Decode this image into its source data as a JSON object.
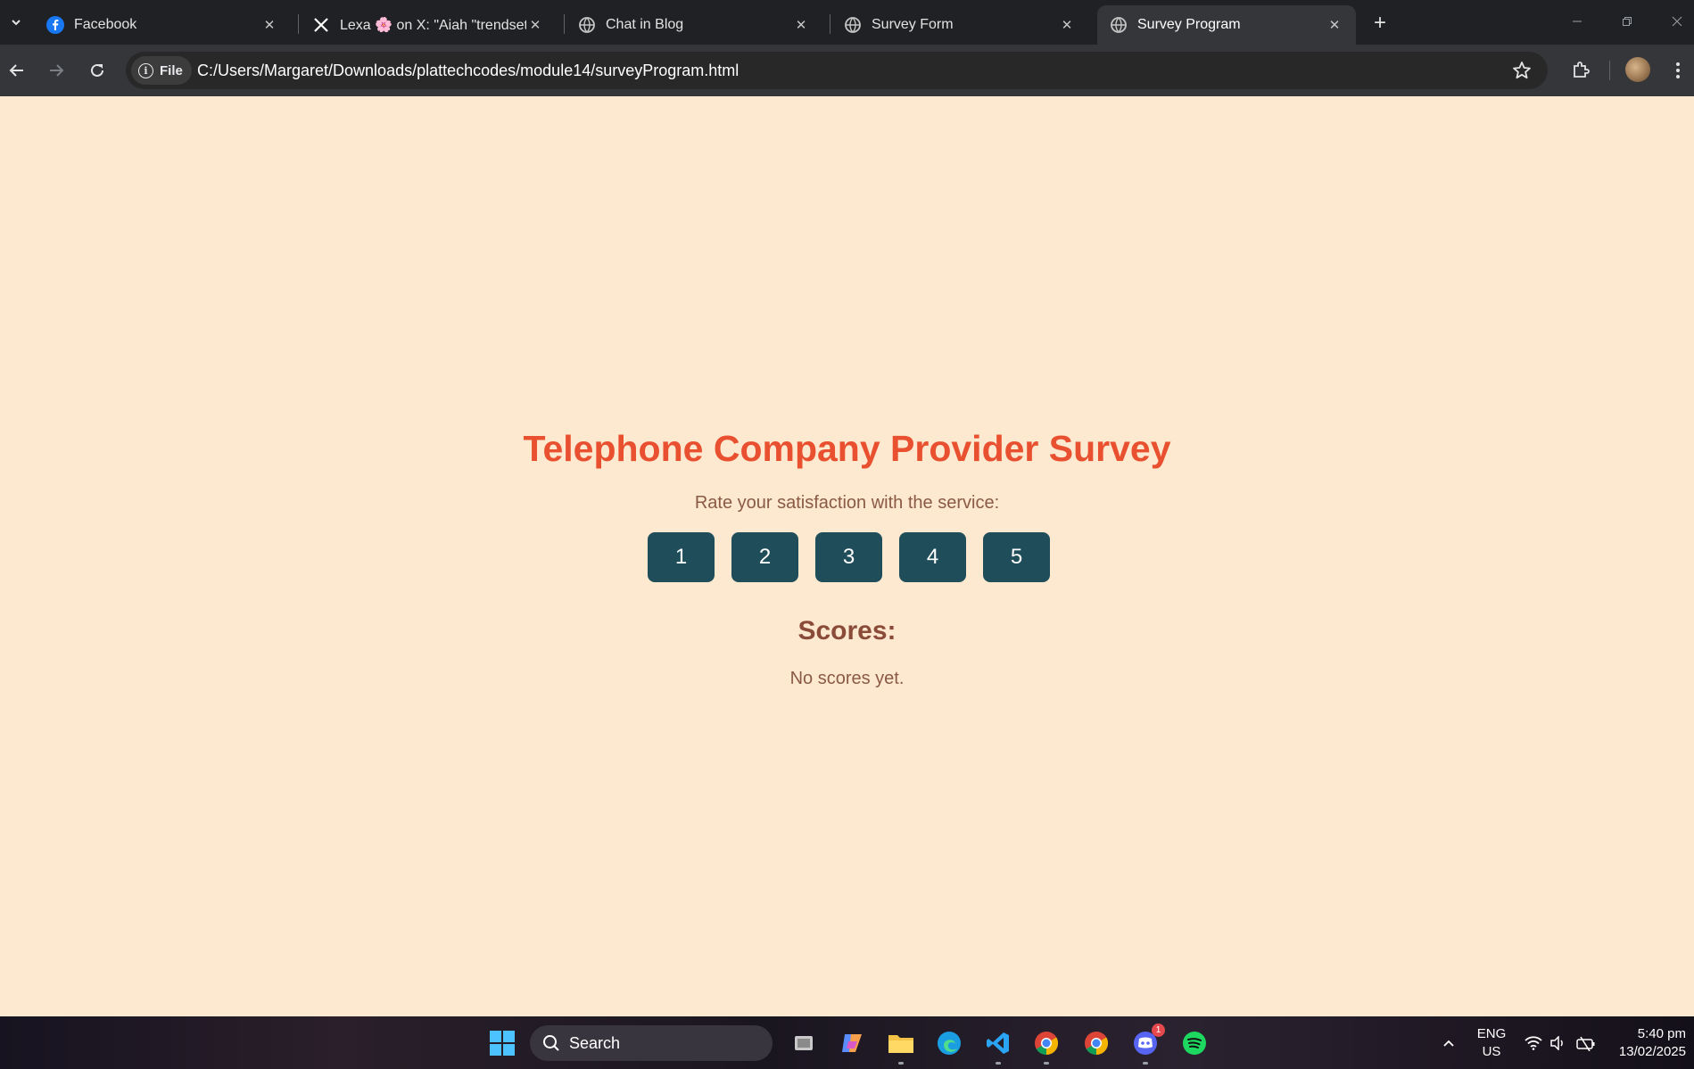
{
  "browser": {
    "tabs": [
      {
        "title": "Facebook",
        "icon": "facebook-icon",
        "active": false
      },
      {
        "title": "Lexa 🌸 on X: \"Aiah \"trendsetter\"",
        "icon": "x-logo-icon",
        "active": false
      },
      {
        "title": "Chat in Blog",
        "icon": "globe-icon",
        "active": false
      },
      {
        "title": "Survey Form",
        "icon": "globe-icon",
        "active": false
      },
      {
        "title": "Survey Program",
        "icon": "globe-icon",
        "active": true
      }
    ],
    "address": {
      "chip_label": "File",
      "url": "C:/Users/Margaret/Downloads/plattechcodes/module14/surveyProgram.html"
    }
  },
  "survey": {
    "title": "Telephone Company Provider Survey",
    "prompt": "Rate your satisfaction with the service:",
    "ratings": [
      "1",
      "2",
      "3",
      "4",
      "5"
    ],
    "scores_heading": "Scores:",
    "scores_text": "No scores yet."
  },
  "taskbar": {
    "search_label": "Search",
    "discord_badge": "1",
    "language": "ENG",
    "region": "US",
    "time": "5:40 pm",
    "date": "13/02/2025"
  },
  "colors": {
    "page_background": "#fde8d0",
    "title": "#e8502f",
    "button": "#1f4e5a",
    "heading": "#8a4b38",
    "text": "#8a5a44"
  }
}
